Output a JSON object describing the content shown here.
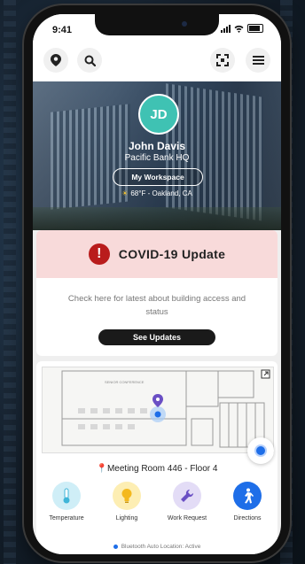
{
  "status": {
    "time": "9:41"
  },
  "profile": {
    "initials": "JD",
    "name": "John Davis",
    "company": "Pacific Bank HQ",
    "workspace_label": "My Workspace",
    "weather": "68°F - Oakland, CA"
  },
  "covid": {
    "title": "COVID-19 Update",
    "body": "Check here for latest about building access and status",
    "button": "See Updates"
  },
  "map": {
    "location_label": "Meeting Room 446 - Floor 4",
    "room_tag": "SENIOR CONFERENCE",
    "actions": [
      {
        "label": "Temperature",
        "icon": "thermometer-icon",
        "color": "#cfeef7"
      },
      {
        "label": "Lighting",
        "icon": "lightbulb-icon",
        "color": "#fdeeb3"
      },
      {
        "label": "Work Request",
        "icon": "wrench-icon",
        "color": "#e3dcf6"
      },
      {
        "label": "Directions",
        "icon": "walking-person-icon",
        "color": "#1e6ee8"
      }
    ],
    "bluetooth_status": "Bluetooth Auto Location: Active"
  },
  "colors": {
    "accent": "#1e6ee8",
    "avatar": "#3fc2b3",
    "alert": "#b91c1c",
    "covid_bg": "#f8dada"
  }
}
